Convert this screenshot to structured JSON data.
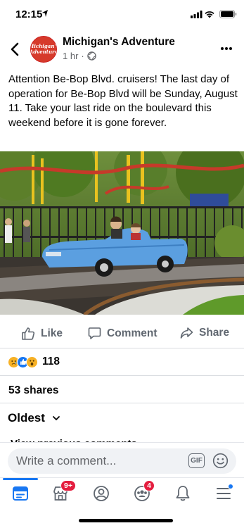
{
  "status": {
    "time": "12:15"
  },
  "post": {
    "page_name": "Michigan's Adventure",
    "avatar_text": "Michigan's Adventure",
    "time": "1 hr",
    "dot": "·",
    "text": "Attention Be-Bop Blvd. cruisers!  The last day of operation for Be-Bop Blvd will be Sunday, August 11.  Take your last ride on the boulevard this weekend before it is gone forever."
  },
  "actions": {
    "like": "Like",
    "comment": "Comment",
    "share": "Share"
  },
  "reactions": {
    "count": "118",
    "types": [
      "sad",
      "like",
      "wow"
    ]
  },
  "shares": "53 shares",
  "comments": {
    "sort_label": "Oldest",
    "view_previous": "View previous comments"
  },
  "composer": {
    "placeholder": "Write a comment...",
    "gif_label": "GIF"
  },
  "tabbar": {
    "tabs": [
      {
        "name": "news-feed",
        "active": true
      },
      {
        "name": "marketplace",
        "badge": "9+"
      },
      {
        "name": "profile"
      },
      {
        "name": "groups",
        "badge": "4"
      },
      {
        "name": "notifications"
      },
      {
        "name": "menu",
        "dot": true
      }
    ]
  },
  "colors": {
    "accent": "#1877f2",
    "badge": "#e41e3f",
    "car": "#5b9fe0",
    "avatar": "#d63a2b"
  }
}
